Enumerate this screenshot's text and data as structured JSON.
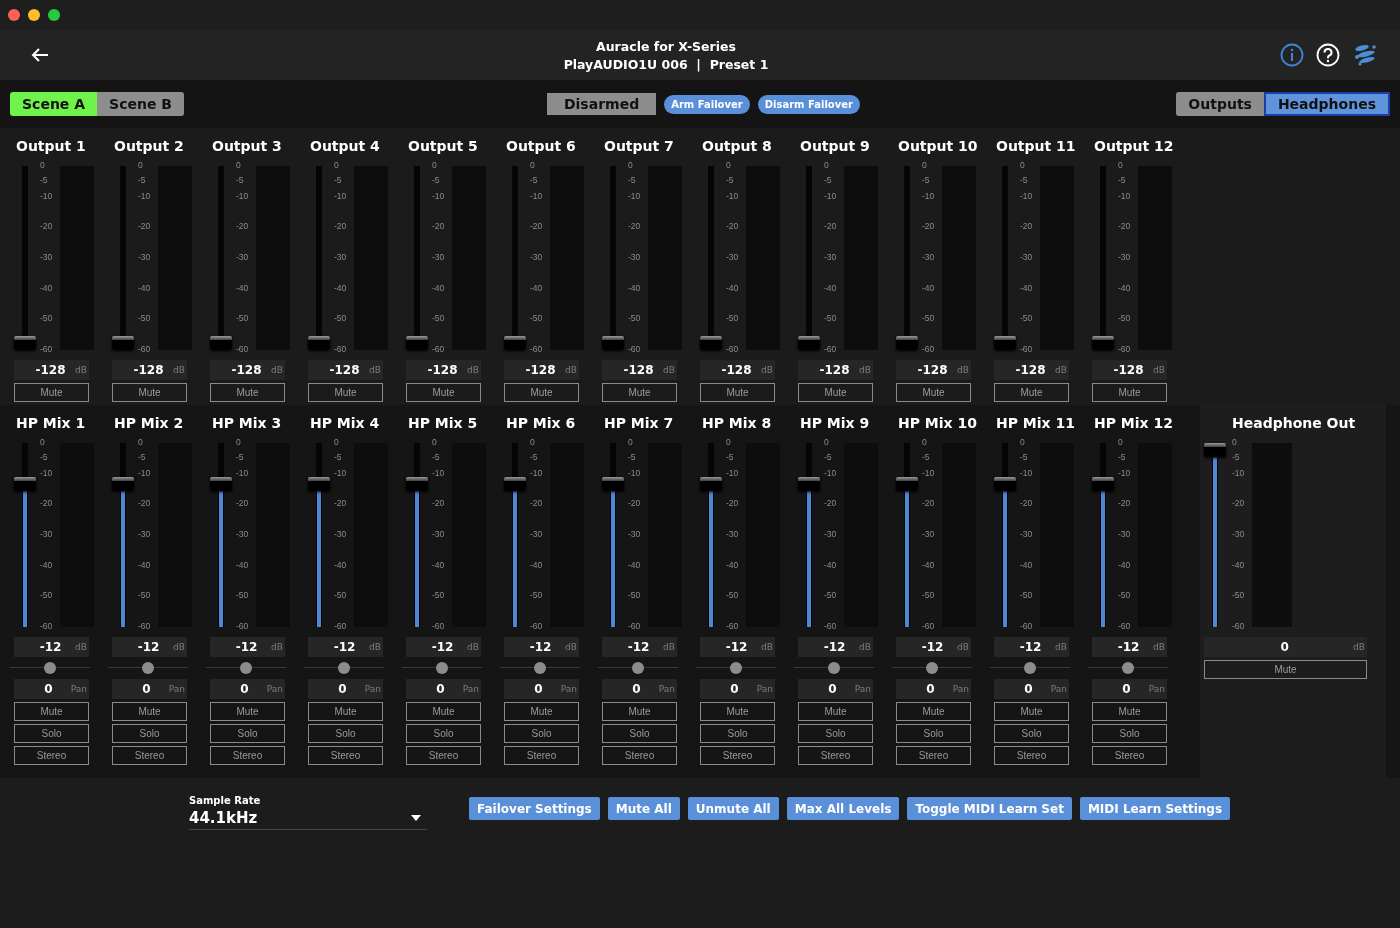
{
  "window": {
    "title": "Auracle for X-Series",
    "subtitle": "PlayAUDIO1U 006  |  Preset 1"
  },
  "scenes": [
    {
      "label": "Scene A",
      "selected": true
    },
    {
      "label": "Scene B",
      "selected": false
    }
  ],
  "arm_status": "Disarmed",
  "failover_buttons": [
    "Arm Failover",
    "Disarm Failover"
  ],
  "views": [
    {
      "label": "Outputs",
      "selected": false
    },
    {
      "label": "Headphones",
      "selected": true
    }
  ],
  "outputs": [
    {
      "name": "Output 1",
      "scale": [
        "0",
        "-5",
        "-10",
        "-20",
        "-30",
        "-40",
        "-50",
        "-60"
      ],
      "level": 0,
      "value": "-128",
      "unit": "dB",
      "buttons": [
        "Mute"
      ]
    },
    {
      "name": "Output 2",
      "scale": [
        "0",
        "-5",
        "-10",
        "-20",
        "-30",
        "-40",
        "-50",
        "-60"
      ],
      "level": 0,
      "value": "-128",
      "unit": "dB",
      "buttons": [
        "Mute"
      ]
    },
    {
      "name": "Output 3",
      "scale": [
        "0",
        "-5",
        "-10",
        "-20",
        "-30",
        "-40",
        "-50",
        "-60"
      ],
      "level": 0,
      "value": "-128",
      "unit": "dB",
      "buttons": [
        "Mute"
      ]
    },
    {
      "name": "Output 4",
      "scale": [
        "0",
        "-5",
        "-10",
        "-20",
        "-30",
        "-40",
        "-50",
        "-60"
      ],
      "level": 0,
      "value": "-128",
      "unit": "dB",
      "buttons": [
        "Mute"
      ]
    },
    {
      "name": "Output 5",
      "scale": [
        "0",
        "-5",
        "-10",
        "-20",
        "-30",
        "-40",
        "-50",
        "-60"
      ],
      "level": 0,
      "value": "-128",
      "unit": "dB",
      "buttons": [
        "Mute"
      ]
    },
    {
      "name": "Output 6",
      "scale": [
        "0",
        "-5",
        "-10",
        "-20",
        "-30",
        "-40",
        "-50",
        "-60"
      ],
      "level": 0,
      "value": "-128",
      "unit": "dB",
      "buttons": [
        "Mute"
      ]
    },
    {
      "name": "Output 7",
      "scale": [
        "0",
        "-5",
        "-10",
        "-20",
        "-30",
        "-40",
        "-50",
        "-60"
      ],
      "level": 0,
      "value": "-128",
      "unit": "dB",
      "buttons": [
        "Mute"
      ]
    },
    {
      "name": "Output 8",
      "scale": [
        "0",
        "-5",
        "-10",
        "-20",
        "-30",
        "-40",
        "-50",
        "-60"
      ],
      "level": 0,
      "value": "-128",
      "unit": "dB",
      "buttons": [
        "Mute"
      ]
    },
    {
      "name": "Output 9",
      "scale": [
        "0",
        "-5",
        "-10",
        "-20",
        "-30",
        "-40",
        "-50",
        "-60"
      ],
      "level": 0,
      "value": "-128",
      "unit": "dB",
      "buttons": [
        "Mute"
      ]
    },
    {
      "name": "Output 10",
      "scale": [
        "0",
        "-5",
        "-10",
        "-20",
        "-30",
        "-40",
        "-50",
        "-60"
      ],
      "level": 0,
      "value": "-128",
      "unit": "dB",
      "buttons": [
        "Mute"
      ]
    },
    {
      "name": "Output 11",
      "scale": [
        "0",
        "-5",
        "-10",
        "-20",
        "-30",
        "-40",
        "-50",
        "-60"
      ],
      "level": 0,
      "value": "-128",
      "unit": "dB",
      "buttons": [
        "Mute"
      ]
    },
    {
      "name": "Output 12",
      "scale": [
        "0",
        "-5",
        "-10",
        "-20",
        "-30",
        "-40",
        "-50",
        "-60"
      ],
      "level": 0,
      "value": "-128",
      "unit": "dB",
      "buttons": [
        "Mute"
      ]
    }
  ],
  "hp_mixes": [
    {
      "name": "HP Mix 1",
      "scale": [
        "0",
        "-5",
        "-10",
        "-20",
        "-30",
        "-40",
        "-50",
        "-60"
      ],
      "level": 0.8,
      "value": "-12",
      "unit": "dB",
      "pan": {
        "level": 0.5,
        "value": "0",
        "unit": "Pan"
      },
      "buttons": [
        "Mute",
        "Solo",
        "Stereo"
      ]
    },
    {
      "name": "HP Mix 2",
      "scale": [
        "0",
        "-5",
        "-10",
        "-20",
        "-30",
        "-40",
        "-50",
        "-60"
      ],
      "level": 0.8,
      "value": "-12",
      "unit": "dB",
      "pan": {
        "level": 0.5,
        "value": "0",
        "unit": "Pan"
      },
      "buttons": [
        "Mute",
        "Solo",
        "Stereo"
      ]
    },
    {
      "name": "HP Mix 3",
      "scale": [
        "0",
        "-5",
        "-10",
        "-20",
        "-30",
        "-40",
        "-50",
        "-60"
      ],
      "level": 0.8,
      "value": "-12",
      "unit": "dB",
      "pan": {
        "level": 0.5,
        "value": "0",
        "unit": "Pan"
      },
      "buttons": [
        "Mute",
        "Solo",
        "Stereo"
      ]
    },
    {
      "name": "HP Mix 4",
      "scale": [
        "0",
        "-5",
        "-10",
        "-20",
        "-30",
        "-40",
        "-50",
        "-60"
      ],
      "level": 0.8,
      "value": "-12",
      "unit": "dB",
      "pan": {
        "level": 0.5,
        "value": "0",
        "unit": "Pan"
      },
      "buttons": [
        "Mute",
        "Solo",
        "Stereo"
      ]
    },
    {
      "name": "HP Mix 5",
      "scale": [
        "0",
        "-5",
        "-10",
        "-20",
        "-30",
        "-40",
        "-50",
        "-60"
      ],
      "level": 0.8,
      "value": "-12",
      "unit": "dB",
      "pan": {
        "level": 0.5,
        "value": "0",
        "unit": "Pan"
      },
      "buttons": [
        "Mute",
        "Solo",
        "Stereo"
      ]
    },
    {
      "name": "HP Mix 6",
      "scale": [
        "0",
        "-5",
        "-10",
        "-20",
        "-30",
        "-40",
        "-50",
        "-60"
      ],
      "level": 0.8,
      "value": "-12",
      "unit": "dB",
      "pan": {
        "level": 0.5,
        "value": "0",
        "unit": "Pan"
      },
      "buttons": [
        "Mute",
        "Solo",
        "Stereo"
      ]
    },
    {
      "name": "HP Mix 7",
      "scale": [
        "0",
        "-5",
        "-10",
        "-20",
        "-30",
        "-40",
        "-50",
        "-60"
      ],
      "level": 0.8,
      "value": "-12",
      "unit": "dB",
      "pan": {
        "level": 0.5,
        "value": "0",
        "unit": "Pan"
      },
      "buttons": [
        "Mute",
        "Solo",
        "Stereo"
      ]
    },
    {
      "name": "HP Mix 8",
      "scale": [
        "0",
        "-5",
        "-10",
        "-20",
        "-30",
        "-40",
        "-50",
        "-60"
      ],
      "level": 0.8,
      "value": "-12",
      "unit": "dB",
      "pan": {
        "level": 0.5,
        "value": "0",
        "unit": "Pan"
      },
      "buttons": [
        "Mute",
        "Solo",
        "Stereo"
      ]
    },
    {
      "name": "HP Mix 9",
      "scale": [
        "0",
        "-5",
        "-10",
        "-20",
        "-30",
        "-40",
        "-50",
        "-60"
      ],
      "level": 0.8,
      "value": "-12",
      "unit": "dB",
      "pan": {
        "level": 0.5,
        "value": "0",
        "unit": "Pan"
      },
      "buttons": [
        "Mute",
        "Solo",
        "Stereo"
      ]
    },
    {
      "name": "HP Mix 10",
      "scale": [
        "0",
        "-5",
        "-10",
        "-20",
        "-30",
        "-40",
        "-50",
        "-60"
      ],
      "level": 0.8,
      "value": "-12",
      "unit": "dB",
      "pan": {
        "level": 0.5,
        "value": "0",
        "unit": "Pan"
      },
      "buttons": [
        "Mute",
        "Solo",
        "Stereo"
      ]
    },
    {
      "name": "HP Mix 11",
      "scale": [
        "0",
        "-5",
        "-10",
        "-20",
        "-30",
        "-40",
        "-50",
        "-60"
      ],
      "level": 0.8,
      "value": "-12",
      "unit": "dB",
      "pan": {
        "level": 0.5,
        "value": "0",
        "unit": "Pan"
      },
      "buttons": [
        "Mute",
        "Solo",
        "Stereo"
      ]
    },
    {
      "name": "HP Mix 12",
      "scale": [
        "0",
        "-5",
        "-10",
        "-20",
        "-30",
        "-40",
        "-50",
        "-60"
      ],
      "level": 0.8,
      "value": "-12",
      "unit": "dB",
      "pan": {
        "level": 0.5,
        "value": "0",
        "unit": "Pan"
      },
      "buttons": [
        "Mute",
        "Solo",
        "Stereo"
      ]
    }
  ],
  "headphone_out": {
    "name": "Headphone Out",
    "scale": [
      "0",
      "-5",
      "-10",
      "-20",
      "-30",
      "-40",
      "-50",
      "-60"
    ],
    "level": 1,
    "value": "0",
    "unit": "dB",
    "buttons": [
      "Mute"
    ]
  },
  "sample_rate": {
    "label": "Sample Rate",
    "value": "44.1kHz"
  },
  "actions": [
    "Failover Settings",
    "Mute All",
    "Unmute All",
    "Max All Levels",
    "Toggle MIDI Learn Set",
    "MIDI Learn Settings"
  ]
}
